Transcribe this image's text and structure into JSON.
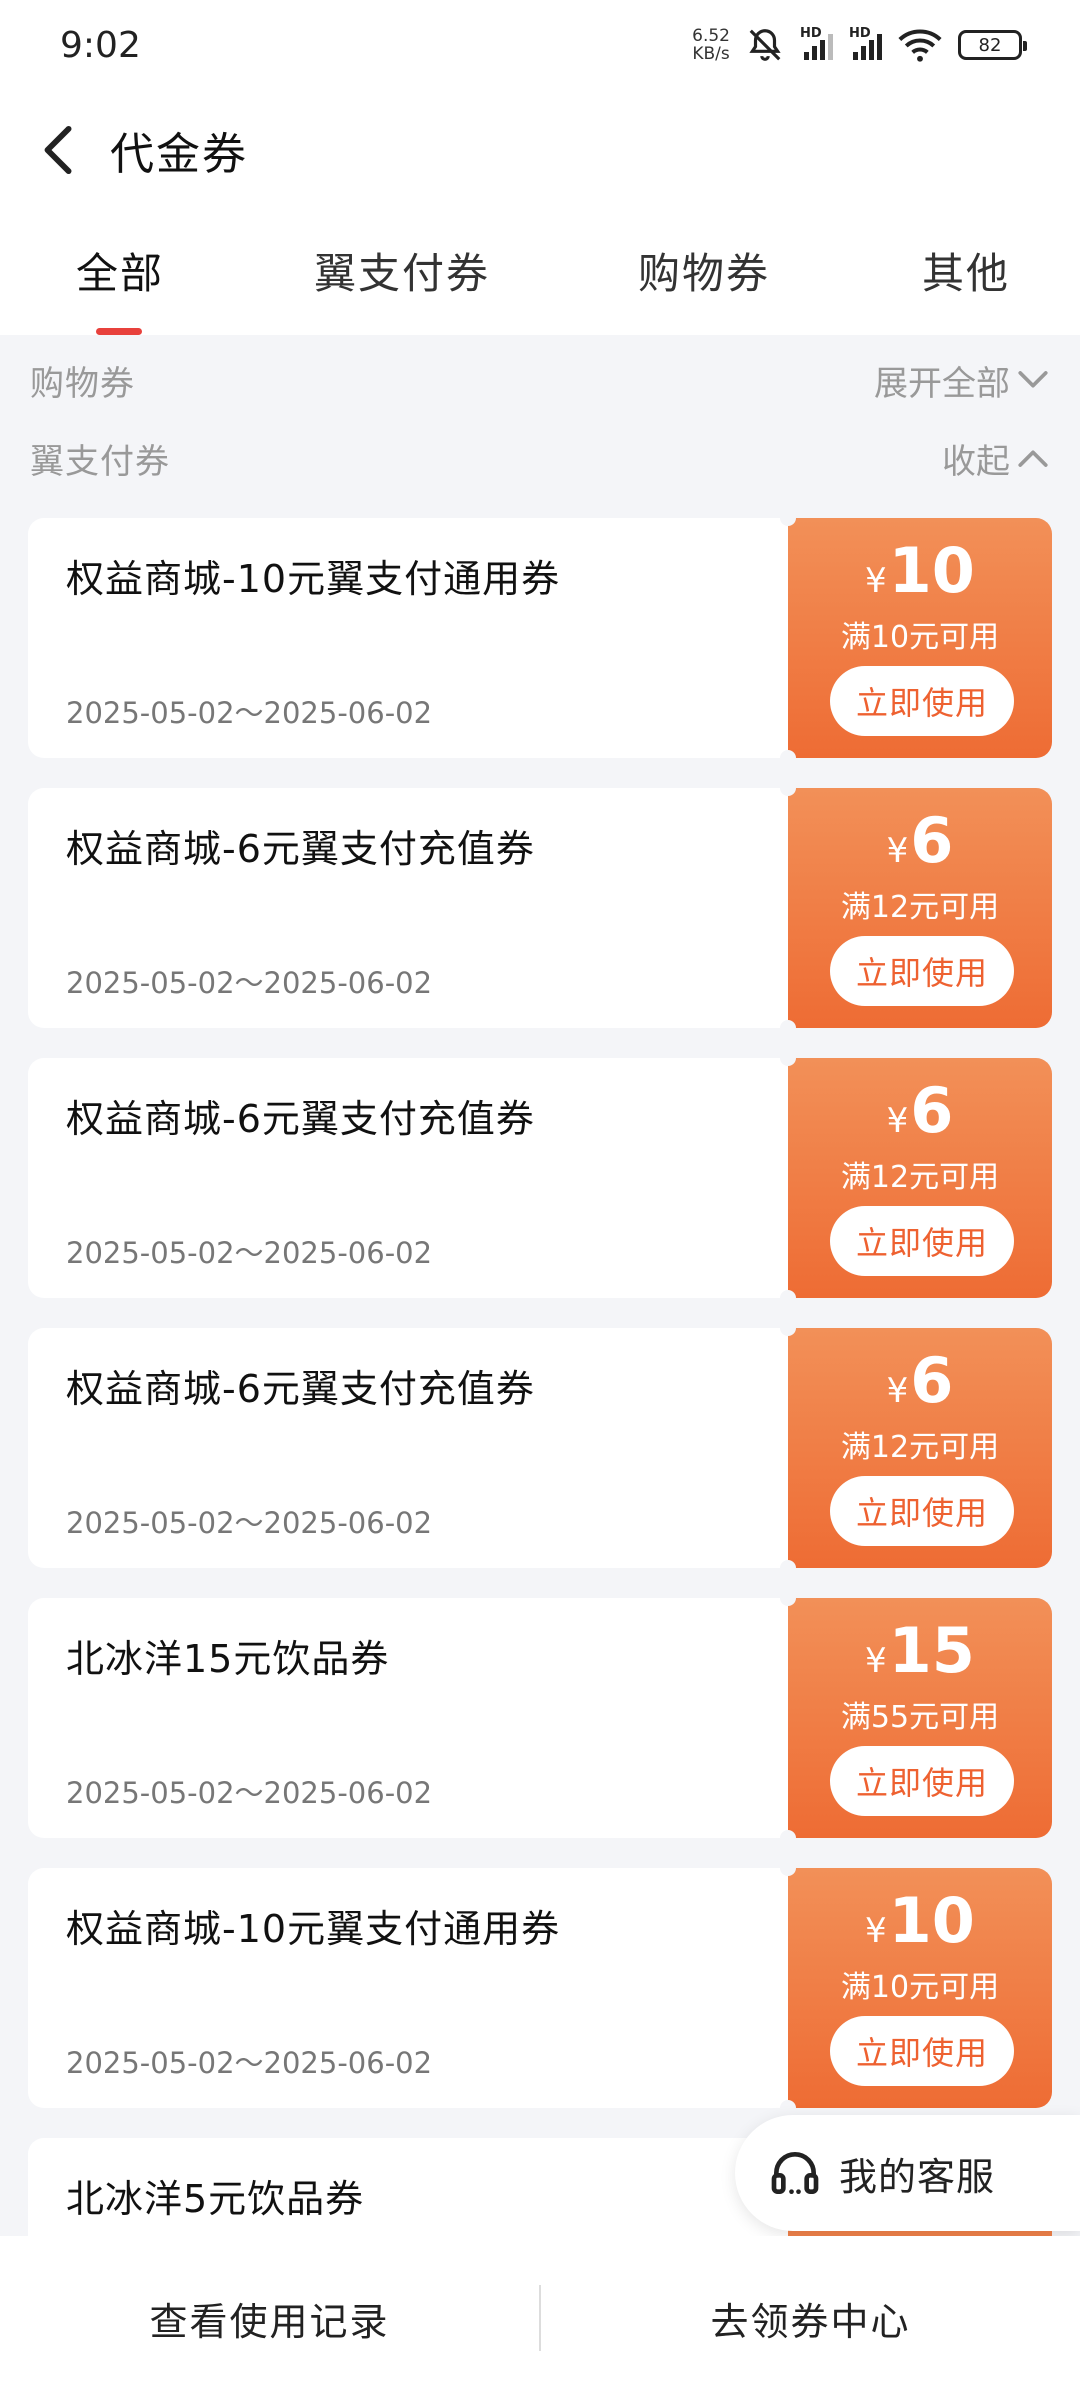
{
  "status_bar": {
    "time": "9:02",
    "net_speed_value": "6.52",
    "net_speed_unit": "KB/s",
    "signal_label_1": "HD",
    "signal_label_2": "HD",
    "battery": "82"
  },
  "header": {
    "title": "代金券"
  },
  "tabs": [
    {
      "label": "全部",
      "active": true
    },
    {
      "label": "翼支付券",
      "active": false
    },
    {
      "label": "购物券",
      "active": false
    },
    {
      "label": "其他",
      "active": false
    }
  ],
  "sections": {
    "shopping": {
      "label": "购物券",
      "toggle": "展开全部"
    },
    "yzf": {
      "label": "翼支付券",
      "toggle": "收起"
    }
  },
  "coupons": [
    {
      "name": "权益商城-10元翼支付通用券",
      "date": "2025-05-02～2025-06-02",
      "currency": "¥",
      "amount": "10",
      "condition": "满10元可用",
      "button": "立即使用"
    },
    {
      "name": "权益商城-6元翼支付充值券",
      "date": "2025-05-02～2025-06-02",
      "currency": "¥",
      "amount": "6",
      "condition": "满12元可用",
      "button": "立即使用"
    },
    {
      "name": "权益商城-6元翼支付充值券",
      "date": "2025-05-02～2025-06-02",
      "currency": "¥",
      "amount": "6",
      "condition": "满12元可用",
      "button": "立即使用"
    },
    {
      "name": "权益商城-6元翼支付充值券",
      "date": "2025-05-02～2025-06-02",
      "currency": "¥",
      "amount": "6",
      "condition": "满12元可用",
      "button": "立即使用"
    },
    {
      "name": "北冰洋15元饮品券",
      "date": "2025-05-02～2025-06-02",
      "currency": "¥",
      "amount": "15",
      "condition": "满55元可用",
      "button": "立即使用"
    },
    {
      "name": "权益商城-10元翼支付通用券",
      "date": "2025-05-02～2025-06-02",
      "currency": "¥",
      "amount": "10",
      "condition": "满10元可用",
      "button": "立即使用"
    },
    {
      "name": "北冰洋5元饮品券",
      "date": "",
      "currency": "",
      "amount": "",
      "condition": "",
      "button": ""
    }
  ],
  "customer_service": {
    "label": "我的客服"
  },
  "bottom_bar": {
    "history_label": "查看使用记录",
    "center_label": "去领券中心"
  },
  "colors": {
    "accent_red": "#e8413c",
    "coupon_orange_top": "#f29058",
    "coupon_orange_bottom": "#ee6c34",
    "background": "#f4f5f8"
  }
}
